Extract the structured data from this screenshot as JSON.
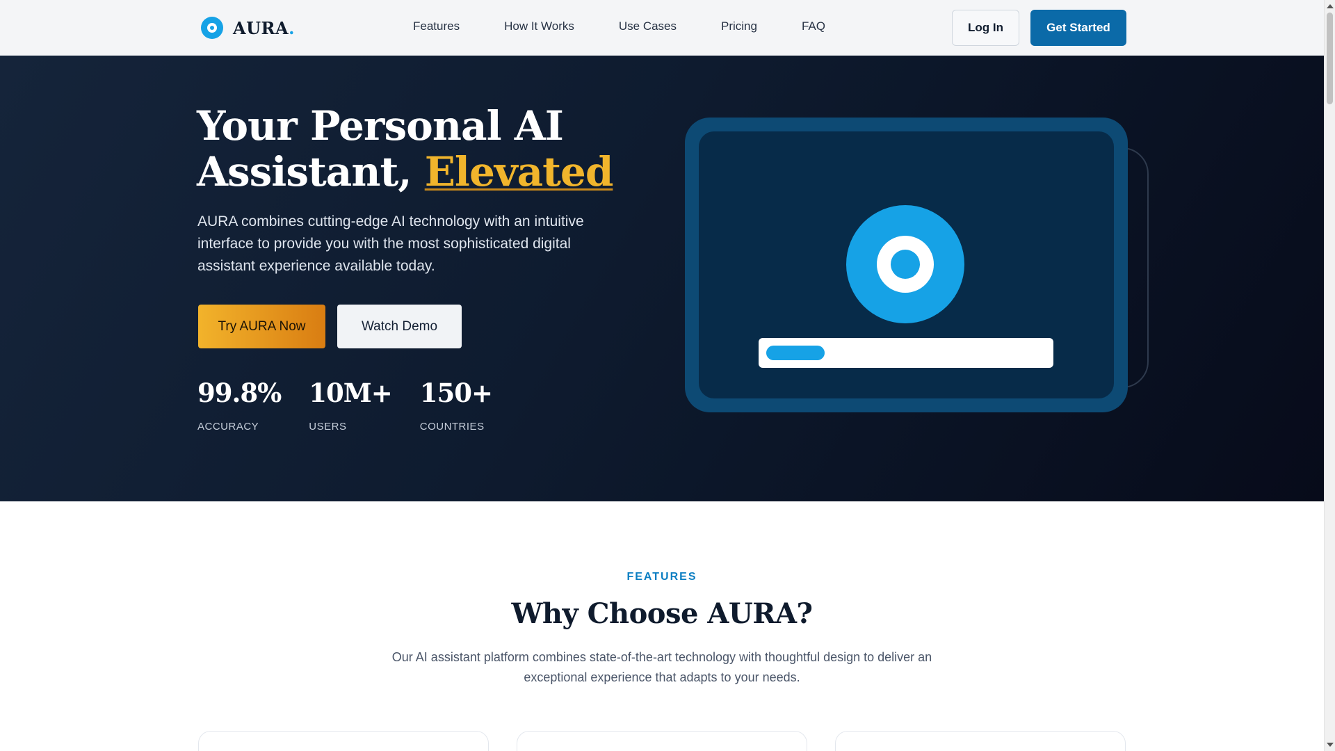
{
  "header": {
    "logo_text": "AURA",
    "logo_period": ".",
    "nav": [
      "Features",
      "How It Works",
      "Use Cases",
      "Pricing",
      "FAQ"
    ],
    "login_label": "Log In",
    "cta_label": "Get Started"
  },
  "hero": {
    "title_line1": "Your Personal AI",
    "title_line2": "Assistant, ",
    "title_accent": "Elevated",
    "description": "AURA combines cutting-edge AI technology with an intuitive interface to provide you with the most sophisticated digital assistant experience available today.",
    "primary_cta": "Try AURA Now",
    "secondary_cta": "Watch Demo",
    "stats": [
      {
        "value": "99.8%",
        "label": "ACCURACY"
      },
      {
        "value": "10M+",
        "label": "USERS"
      },
      {
        "value": "150+",
        "label": "COUNTRIES"
      }
    ]
  },
  "features": {
    "eyebrow": "FEATURES",
    "title": "Why Choose AURA?",
    "description": "Our AI assistant platform combines state-of-the-art technology with thoughtful design to deliver an exceptional experience that adapts to your needs."
  },
  "colors": {
    "brand": "#16a2e6",
    "accent": "#f1b52c",
    "primary_button": "#0b6aa8",
    "hero_bg": "#0e1b2f"
  }
}
